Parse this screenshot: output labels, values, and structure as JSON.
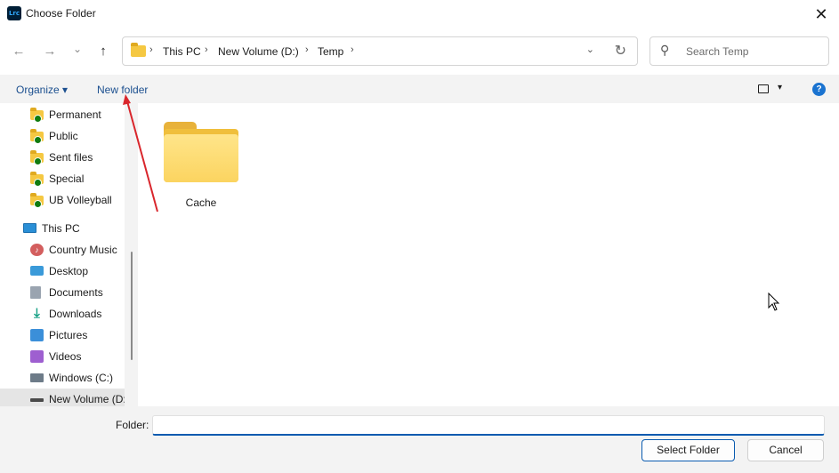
{
  "window": {
    "app_icon_text": "Lrc",
    "title": "Choose Folder",
    "close_glyph": "✕"
  },
  "nav": {
    "back_glyph": "←",
    "forward_glyph": "→",
    "recent_glyph": "⌄",
    "up_glyph": "↑",
    "breadcrumbs": [
      "This PC",
      "New Volume (D:)",
      "Temp"
    ],
    "crumb_separator": "›",
    "dropdown_glyph": "⌄",
    "refresh_glyph": "↻",
    "search_placeholder": "Search Temp",
    "search_glyph": "⚲"
  },
  "commandbar": {
    "organize_label": "Organize ▾",
    "new_folder_label": "New folder",
    "view_dropdown_glyph": "▾",
    "help_glyph": "?"
  },
  "sidebar": {
    "items": [
      {
        "label": "Permanent",
        "icon": "folder-synced-icon"
      },
      {
        "label": "Public",
        "icon": "folder-synced-icon"
      },
      {
        "label": "Sent files",
        "icon": "folder-synced-icon"
      },
      {
        "label": "Special",
        "icon": "folder-synced-icon"
      },
      {
        "label": "UB Volleyball",
        "icon": "folder-synced-icon"
      },
      {
        "label": "This PC",
        "icon": "computer-icon"
      },
      {
        "label": "Country Music",
        "icon": "music-icon"
      },
      {
        "label": "Desktop",
        "icon": "desktop-icon"
      },
      {
        "label": "Documents",
        "icon": "documents-icon"
      },
      {
        "label": "Downloads",
        "icon": "downloads-icon"
      },
      {
        "label": "Pictures",
        "icon": "pictures-icon"
      },
      {
        "label": "Videos",
        "icon": "videos-icon"
      },
      {
        "label": "Windows (C:)",
        "icon": "windows-drive-icon"
      },
      {
        "label": "New Volume (D:",
        "icon": "drive-icon",
        "selected": true
      }
    ]
  },
  "content": {
    "items": [
      {
        "label": "Cache",
        "icon": "folder-icon"
      }
    ]
  },
  "footer": {
    "folder_label": "Folder:",
    "folder_value": "",
    "select_button": "Select Folder",
    "cancel_button": "Cancel"
  },
  "colors": {
    "accent": "#0a5bb0",
    "annotation_arrow": "#d9262c",
    "folder_yellow": "#f5c842"
  }
}
